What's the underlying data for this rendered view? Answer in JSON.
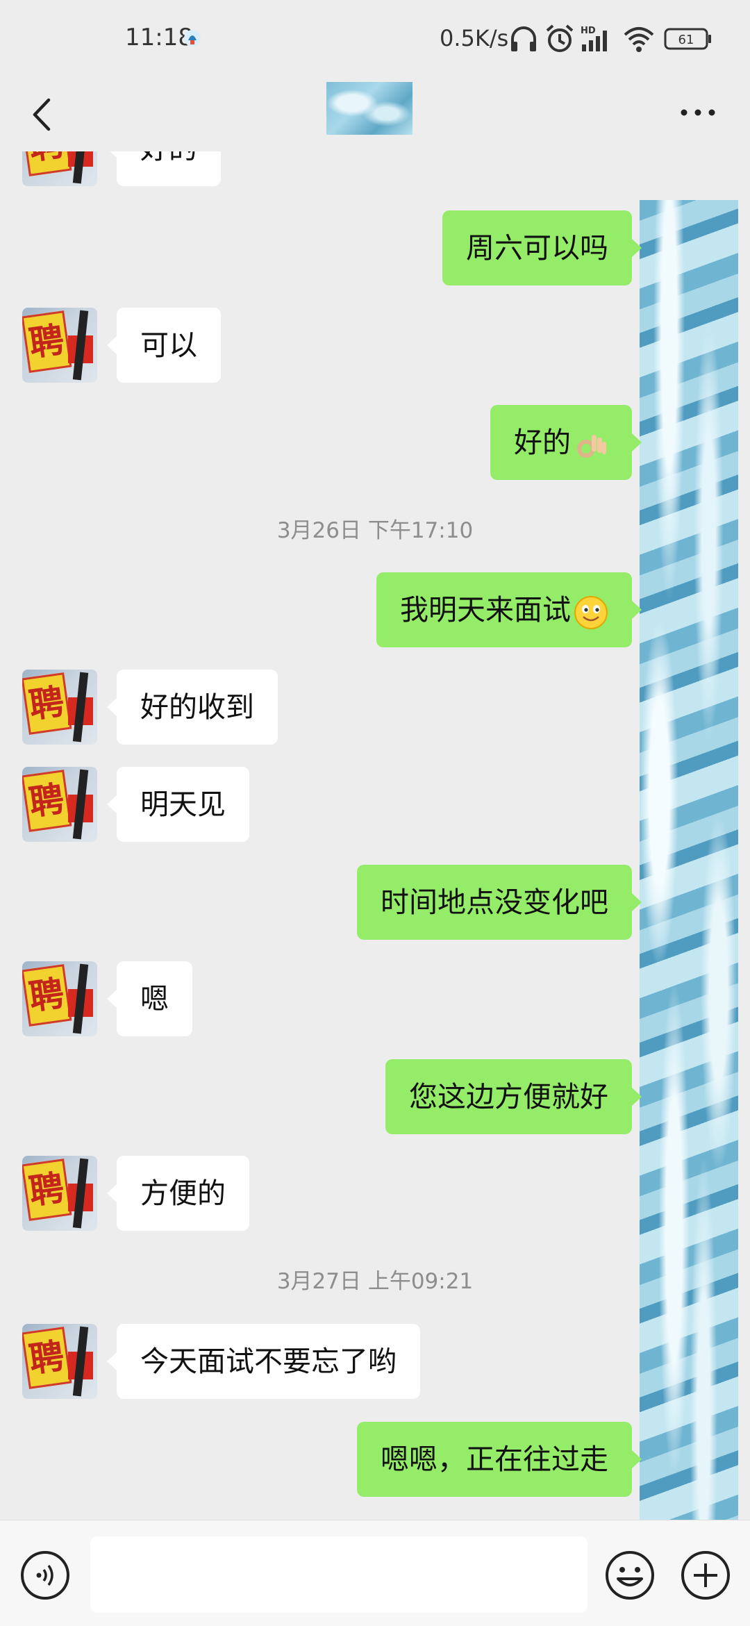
{
  "status_bar": {
    "time": "11:18",
    "net_speed": "0.5K/s",
    "battery": "61",
    "signal_label": "HD"
  },
  "header": {
    "back_icon": "chevron-left-icon",
    "more_icon": "more-dots-icon"
  },
  "messages": [
    {
      "side": "in",
      "text": "好的"
    },
    {
      "side": "out",
      "text": "周六可以吗"
    },
    {
      "side": "in",
      "text": "可以"
    },
    {
      "side": "out",
      "text": "好的",
      "emoji": "ok-hand-emoji"
    },
    {
      "timestamp": "3月26日 下午17:10"
    },
    {
      "side": "out",
      "text": "我明天来面试",
      "emoji": "smile-emoji"
    },
    {
      "side": "in",
      "text": "好的收到"
    },
    {
      "side": "in",
      "text": "明天见"
    },
    {
      "side": "out",
      "text": "时间地点没变化吧"
    },
    {
      "side": "in",
      "text": "嗯"
    },
    {
      "side": "out",
      "text": "您这边方便就好"
    },
    {
      "side": "in",
      "text": "方便的"
    },
    {
      "timestamp": "3月27日 上午09:21"
    },
    {
      "side": "in",
      "text": "今天面试不要忘了哟"
    },
    {
      "side": "out",
      "text": "嗯嗯，正在往过走"
    }
  ],
  "avatar_text": "聘",
  "input_bar": {
    "value": "",
    "voice_icon": "voice-icon",
    "emoji_icon": "emoji-icon",
    "plus_icon": "plus-icon"
  }
}
